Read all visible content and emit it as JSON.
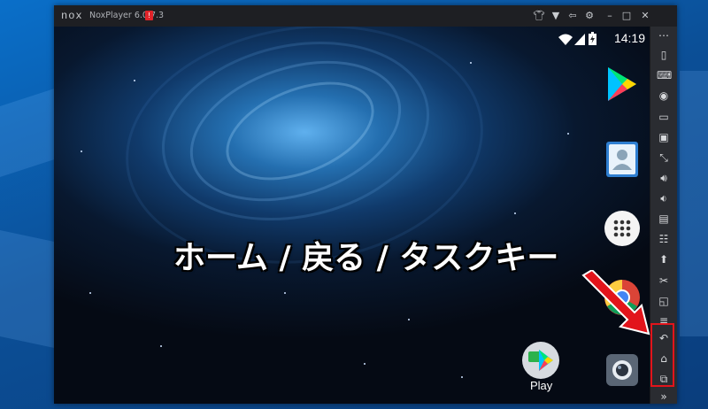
{
  "window": {
    "logo": "nox",
    "title": "NoxPlayer 6.0.7.3",
    "badge": "!",
    "controls": [
      "tshirt-icon",
      "chevron-down-icon",
      "pin-icon",
      "settings-icon",
      "minimize-icon",
      "maximize-icon",
      "close-icon"
    ]
  },
  "statusbar": {
    "time": "14:19",
    "icons": [
      "wifi-icon",
      "signal-icon",
      "battery-icon"
    ]
  },
  "desktop_apps": [
    {
      "name": "Play Store"
    },
    {
      "name": "Contacts"
    },
    {
      "name": "App Drawer"
    },
    {
      "name": "Chrome"
    },
    {
      "name": "Camera"
    },
    {
      "name": "Play",
      "label": "Play"
    }
  ],
  "sidebar": {
    "items": [
      "more-icon",
      "shake-icon",
      "keyboard-icon",
      "location-icon",
      "screen-icon",
      "screenshot-icon",
      "fullscreen-icon",
      "volume-up-icon",
      "volume-down-icon",
      "apk-icon",
      "multi-instance-icon",
      "import-icon",
      "cut-icon",
      "macro-icon",
      "menu-icon",
      "back-icon",
      "home-icon",
      "recents-icon",
      "expand-icon"
    ]
  },
  "annotation": {
    "caption": "ホーム / 戻る / タスクキー",
    "arrow_color": "#e2141b"
  }
}
